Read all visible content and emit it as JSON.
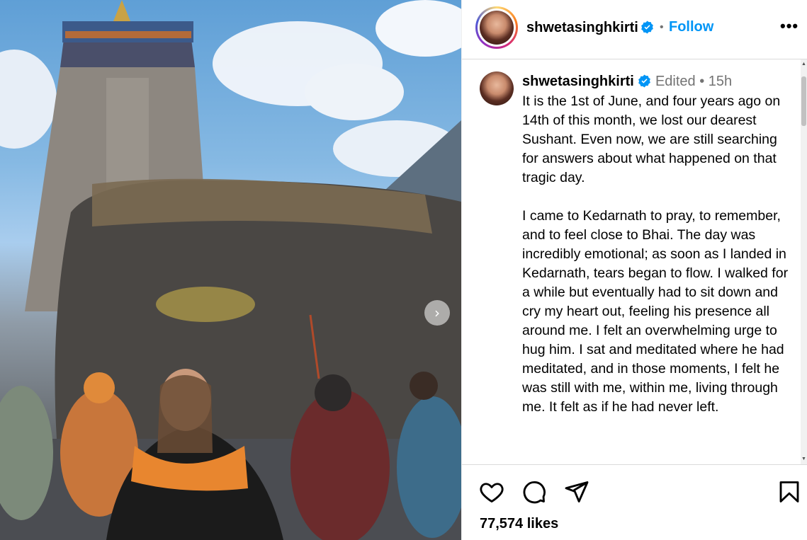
{
  "post": {
    "username": "shwetasinghkirti",
    "follow_label": "Follow",
    "dot": "•",
    "more_label": "•••"
  },
  "caption": {
    "username": "shwetasinghkirti",
    "edited": "Edited",
    "dot": "•",
    "time": "15h",
    "text": "It is the 1st of June, and four years ago on 14th of this month, we lost our dearest Sushant. Even now, we are still searching for answers about what happened on that tragic day.\n\nI came to Kedarnath to pray, to remember, and to feel close to Bhai. The day was incredibly emotional; as soon as I landed in Kedarnath, tears began to flow. I walked for a while but eventually had to sit down and cry my heart out, feeling his presence all around me. I felt an overwhelming urge to hug him. I sat and meditated where he had meditated, and in those moments, I felt he was still with me, within me, living through me. It felt as if he had never left."
  },
  "actions": {
    "likes": "77,574 likes",
    "like_icon": "heart-icon",
    "comment_icon": "comment-icon",
    "share_icon": "paper-plane-icon",
    "save_icon": "bookmark-icon"
  },
  "colors": {
    "accent": "#0095f6",
    "verified": "#0095f6",
    "muted": "#737373"
  }
}
